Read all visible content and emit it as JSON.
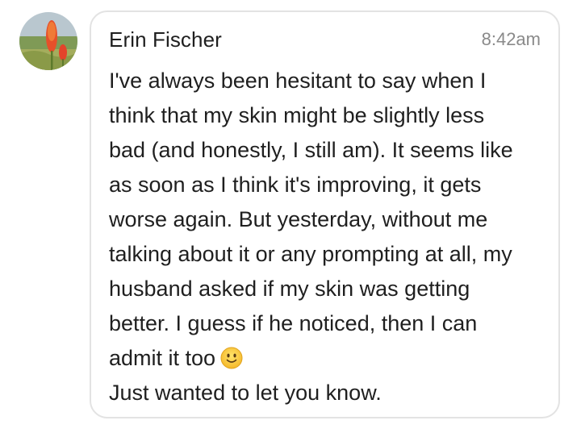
{
  "message": {
    "sender": "Erin Fischer",
    "time": "8:42am",
    "lines": [
      "I've always been hesitant to say when I",
      "think that my skin might be slightly less",
      "bad (and honestly, I still am). It seems like",
      "as soon as I think it's improving, it gets",
      "worse again. But yesterday, without me",
      "talking about it or any prompting at all, my",
      "husband asked if my skin was getting",
      "better. I guess if he noticed, then I can",
      "admit it too",
      "Just wanted to let you know."
    ],
    "emoji": "slightly-smiling-face-icon",
    "avatar": "red-hot-poker-flower-photo"
  },
  "colors": {
    "text": "#1f1f1f",
    "time": "#8a8a8a",
    "border": "#e3e3e3"
  }
}
